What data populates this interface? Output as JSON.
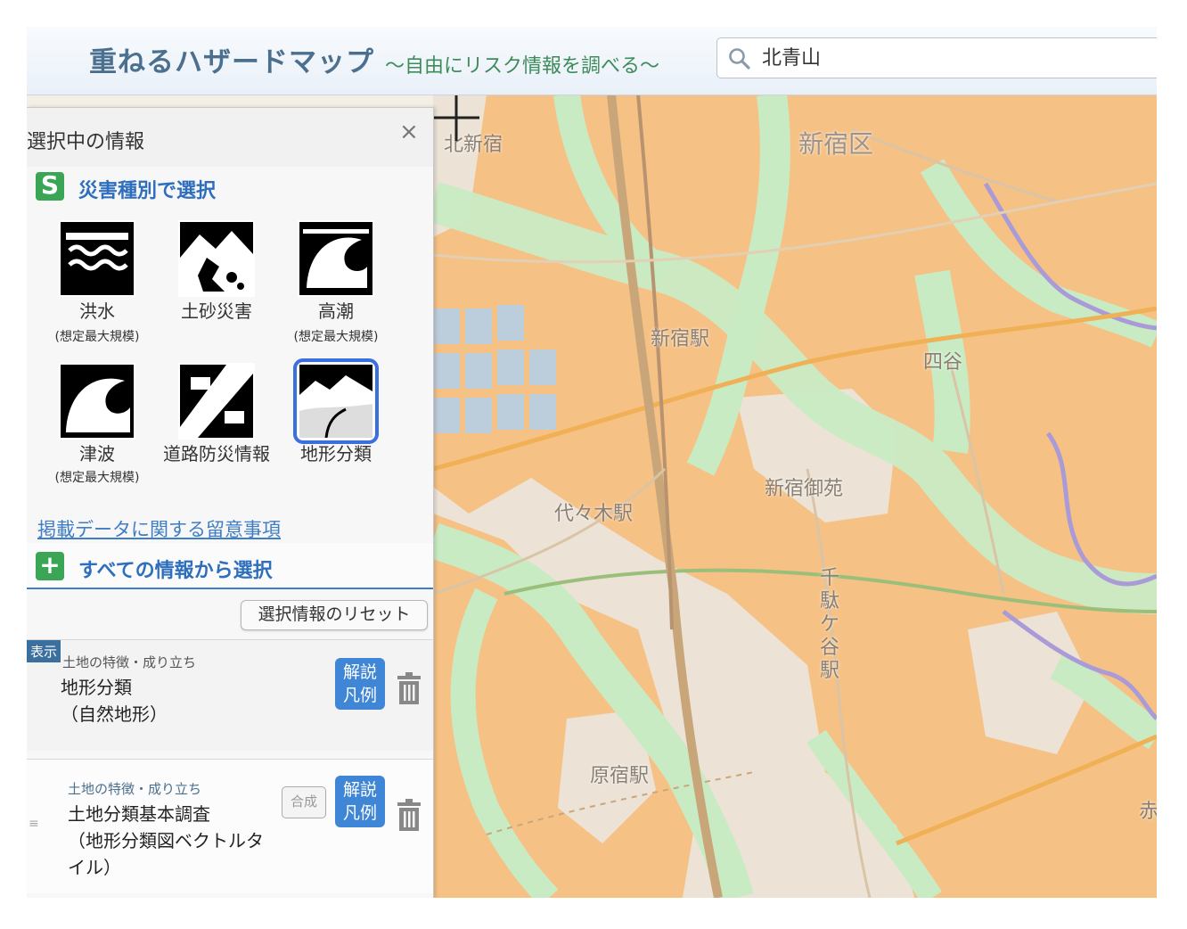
{
  "header": {
    "title": "重ねるハザードマップ",
    "subtitle": "～自由にリスク情報を調べる～",
    "search_value": "北青山"
  },
  "panel": {
    "title": "選択中の情報",
    "close_glyph": "×",
    "disaster_section": {
      "icon": "S",
      "label": "災害種別で選択"
    },
    "tiles": [
      {
        "label": "洪水",
        "note": "(想定最大規模)",
        "icon": "flood-icon"
      },
      {
        "label": "土砂災害",
        "note": "",
        "icon": "landslide-icon"
      },
      {
        "label": "高潮",
        "note": "(想定最大規模)",
        "icon": "storm-surge-icon"
      },
      {
        "label": "津波",
        "note": "(想定最大規模)",
        "icon": "tsunami-icon"
      },
      {
        "label": "道路防災情報",
        "note": "",
        "icon": "road-disaster-icon"
      },
      {
        "label": "地形分類",
        "note": "",
        "icon": "terrain-classification-icon",
        "selected": true
      }
    ],
    "notice_link": "掲載データに関する留意事項",
    "all_section": {
      "icon": "+",
      "label": "すべての情報から選択"
    },
    "reset_button": "選択情報のリセット",
    "layers": [
      {
        "badge": "表示",
        "category": "土地の特徴・成り立ち",
        "name_lines": [
          "地形分類",
          "（自然地形）"
        ],
        "legend_lines": [
          "解説",
          "凡例"
        ]
      },
      {
        "category": "土地の特徴・成り立ち",
        "name_lines": [
          "土地分類基本調査",
          "（地形分類図ベクトルタ",
          "イル）"
        ],
        "combine": "合成",
        "legend_lines": [
          "解説",
          "凡例"
        ]
      }
    ]
  },
  "map": {
    "labels": {
      "kitashinjuku": "北新宿",
      "shinjuku_ku": "新宿区",
      "shinjuku_eki": "新宿駅",
      "yotsuya": "四谷",
      "shinjuku_gyoen": "新宿御苑",
      "yoyogi_eki": "代々木駅",
      "sendagaya_eki": "千駄ケ谷駅",
      "harajuku_eki": "原宿駅",
      "aka": "赤"
    },
    "colors": {
      "terrace": "#f6c184",
      "lowland": "#ece3d6",
      "valley": "#c9ebc4",
      "water_channel": "#a99ad8"
    }
  }
}
